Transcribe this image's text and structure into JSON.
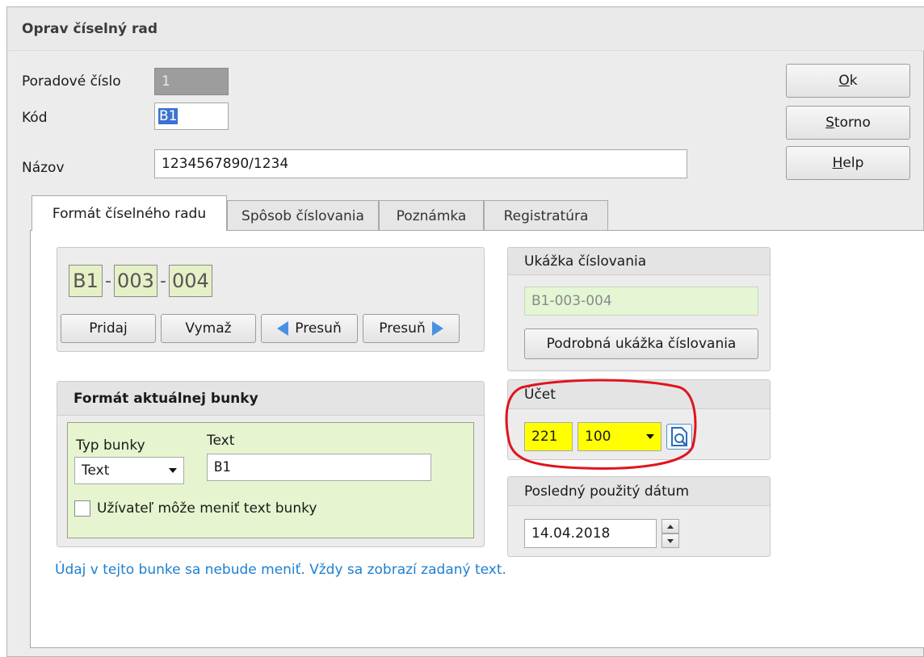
{
  "dialog": {
    "title": "Oprav číselný rad"
  },
  "fields": {
    "poradove_label": "Poradové číslo",
    "poradove_value": "1",
    "kod_label": "Kód",
    "kod_value": "B1",
    "nazov_label": "Názov",
    "nazov_value": "1234567890/1234"
  },
  "buttons": {
    "ok_key": "O",
    "ok_rest": "k",
    "storno_key": "S",
    "storno_rest": "torno",
    "help_key": "H",
    "help_rest": "elp"
  },
  "tabs": [
    {
      "label": "Formát číselného radu",
      "active": true
    },
    {
      "label": "Spôsob číslovania"
    },
    {
      "label": "Poznámka"
    },
    {
      "label": "Registratúra"
    }
  ],
  "format": {
    "cells": [
      "B1",
      "003",
      "004"
    ],
    "separator": "-",
    "btn_pridaj": "Pridaj",
    "btn_vymaz": "Vymaž",
    "btn_presun_left": "Presuň",
    "btn_presun_right": "Presuň"
  },
  "cell_format": {
    "heading": "Formát aktuálnej bunky",
    "typ_label": "Typ bunky",
    "typ_value": "Text",
    "text_label": "Text",
    "text_value": "B1",
    "checkbox_label": "Užívateľ môže meniť text bunky",
    "checkbox_checked": false
  },
  "hint": "Údaj v tejto bunke sa nebude meniť. Vždy sa zobrazí zadaný text.",
  "preview": {
    "heading": "Ukážka číslovania",
    "value": "B1-003-004",
    "detail_button": "Podrobná ukážka číslovania"
  },
  "account": {
    "heading": "Účet",
    "value1": "221",
    "value2": "100",
    "highlight_color": "#ffff00",
    "circle_color": "#e0141e"
  },
  "last_date": {
    "heading": "Posledný použitý dátum",
    "value": "14.04.2018"
  },
  "icons": {
    "lookup": "search-document-icon",
    "move_left": "arrow-left-icon",
    "move_right": "arrow-right-icon",
    "dropdown": "chevron-down-icon"
  }
}
